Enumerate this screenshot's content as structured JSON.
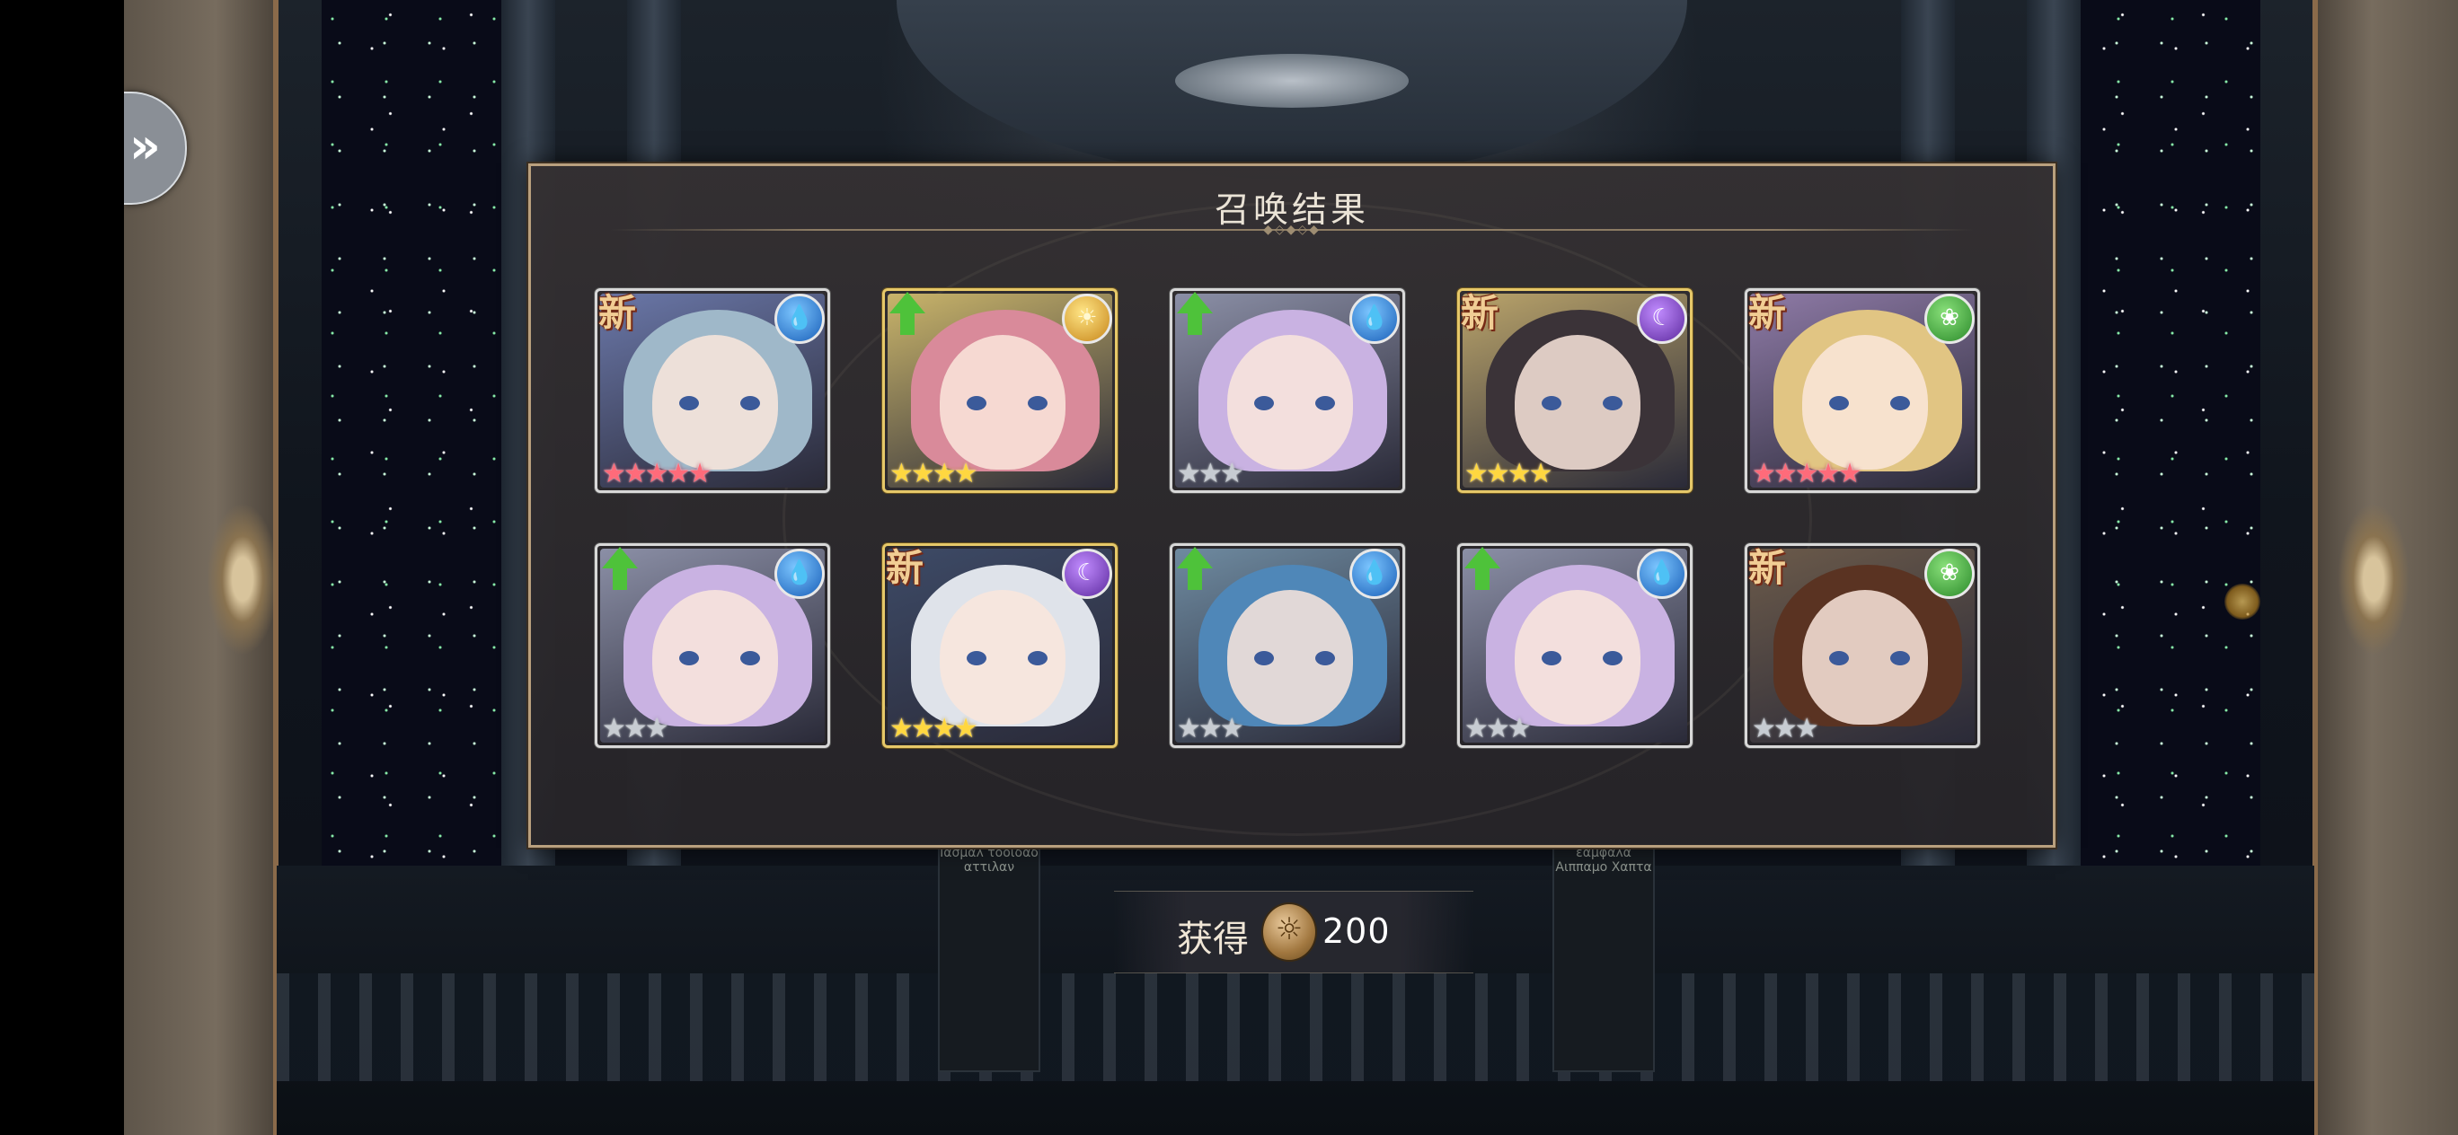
{
  "panel": {
    "title": "召唤结果",
    "ornament": "◆◇◆◇◆"
  },
  "reward": {
    "label": "获得",
    "amount": "200",
    "icon": "coin-icon"
  },
  "signs": {
    "left": "Ιασμαλ\nτοοιδαδ\nαττιλαν",
    "right": "εαμφαλα\nΑιππαμο\nΧαπτα"
  },
  "nav": {
    "icon": "double-chevron-right-icon",
    "glyph": "»"
  },
  "cards": [
    {
      "badge": "new",
      "badge_text": "新",
      "element": "water",
      "element_glyph": "💧",
      "stars": "★★★★★",
      "rarity": 5,
      "frame": "silver",
      "hair": "#9fb8c9",
      "bg": "#6a77a8"
    },
    {
      "badge": "up",
      "badge_text": "",
      "element": "light",
      "element_glyph": "☀",
      "stars": "★★★★",
      "rarity": 4,
      "frame": "gold",
      "hair": "#d98a9a",
      "bg": "#c9b46a"
    },
    {
      "badge": "up",
      "badge_text": "",
      "element": "water",
      "element_glyph": "💧",
      "stars": "★★★",
      "rarity": 3,
      "frame": "silver",
      "hair": "#c9b2e2",
      "bg": "#8b8fa6"
    },
    {
      "badge": "new",
      "badge_text": "新",
      "element": "dark",
      "element_glyph": "☾",
      "stars": "★★★★",
      "rarity": 4,
      "frame": "gold",
      "hair": "#3b3338",
      "bg": "#b9a36a"
    },
    {
      "badge": "new",
      "badge_text": "新",
      "element": "wind",
      "element_glyph": "❀",
      "stars": "★★★★★",
      "rarity": 5,
      "frame": "silver",
      "hair": "#e1c583",
      "bg": "#8e7aa6"
    },
    {
      "badge": "up",
      "badge_text": "",
      "element": "water",
      "element_glyph": "💧",
      "stars": "★★★",
      "rarity": 3,
      "frame": "silver",
      "hair": "#c9b2e2",
      "bg": "#8b8fa6"
    },
    {
      "badge": "new",
      "badge_text": "新",
      "element": "dark",
      "element_glyph": "☾",
      "stars": "★★★★",
      "rarity": 4,
      "frame": "gold",
      "hair": "#dfe3ea",
      "bg": "#3d4a66"
    },
    {
      "badge": "up",
      "badge_text": "",
      "element": "water",
      "element_glyph": "💧",
      "stars": "★★★",
      "rarity": 3,
      "frame": "silver",
      "hair": "#4f87b8",
      "bg": "#6e8aa0"
    },
    {
      "badge": "up",
      "badge_text": "",
      "element": "water",
      "element_glyph": "💧",
      "stars": "★★★",
      "rarity": 3,
      "frame": "silver",
      "hair": "#c9b2e2",
      "bg": "#8b8fa6"
    },
    {
      "badge": "new",
      "badge_text": "新",
      "element": "wind",
      "element_glyph": "❀",
      "stars": "★★★",
      "rarity": 3,
      "frame": "silver",
      "hair": "#5a3322",
      "bg": "#6b5a4a"
    }
  ]
}
